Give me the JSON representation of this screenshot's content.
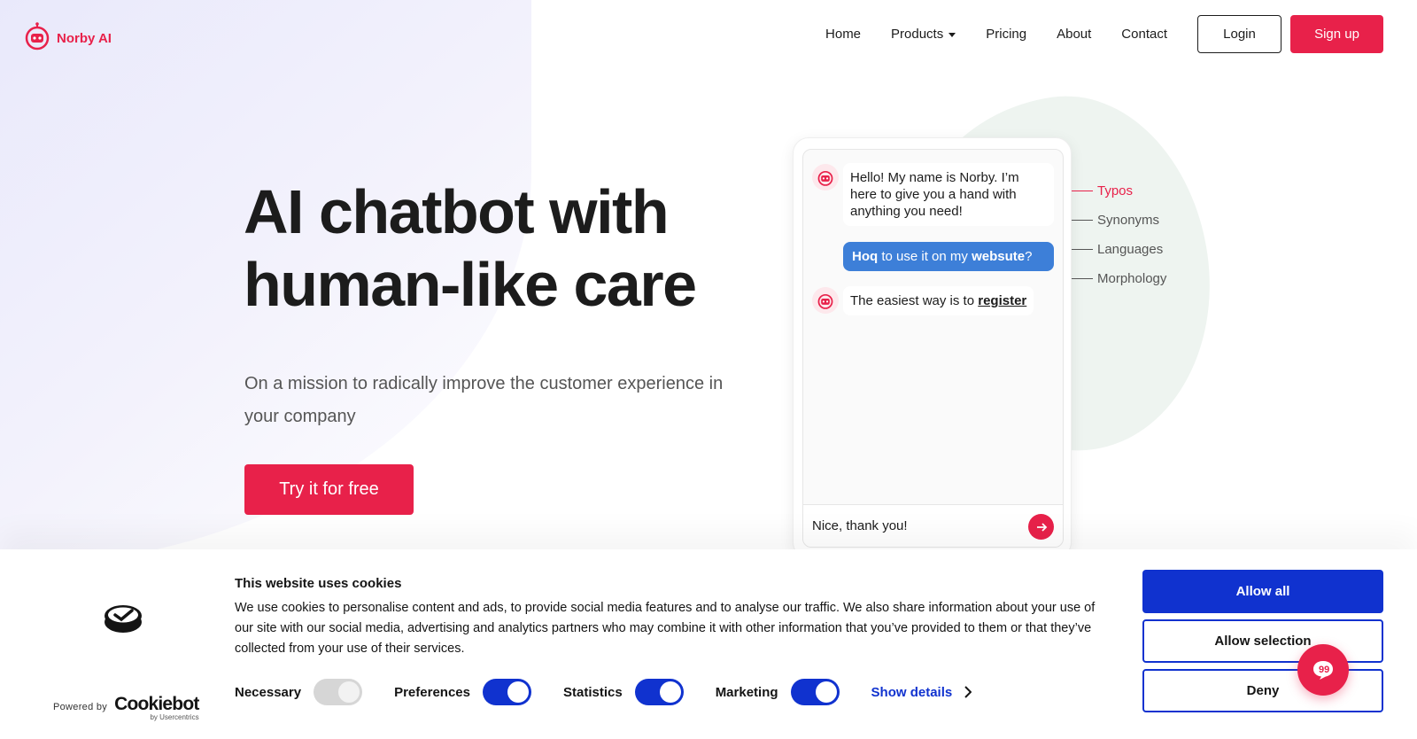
{
  "brand": {
    "name": "Norby AI",
    "accent": "#e8214a",
    "icon": "robot-icon"
  },
  "nav": {
    "home": "Home",
    "products": "Products",
    "pricing": "Pricing",
    "about": "About",
    "contact": "Contact",
    "login": "Login",
    "signup": "Sign up"
  },
  "hero": {
    "title_line1": "AI chatbot with",
    "title_line2": "human-like care",
    "subtitle": "On a mission to radically improve the customer experience in your company",
    "cta": "Try it for free"
  },
  "chat": {
    "bot_greeting": "Hello! My name is Norby. I’m here to give you a hand with anything you need!",
    "user_msg": {
      "word1": "Hoq",
      "middle": " to use it on my ",
      "word2": "websute",
      "end": "?"
    },
    "bot_reply_prefix": "The easiest way is to ",
    "bot_reply_link": "register",
    "input_value": "Nice, thank you!",
    "send_icon": "arrow-right-icon"
  },
  "features": [
    "Typos",
    "Synonyms",
    "Languages",
    "Morphology"
  ],
  "cookie": {
    "title": "This website uses cookies",
    "text": "We use cookies to personalise content and ads, to provide social media features and to analyse our traffic. We also share information about your use of our site with our social media, advertising and analytics partners who may combine it with other information that you’ve provided to them or that they’ve collected from your use of their services.",
    "powered_by": "Powered by",
    "brand": "Cookiebot",
    "brand_sub": "by Usercentrics",
    "toggles": {
      "necessary": "Necessary",
      "preferences": "Preferences",
      "statistics": "Statistics",
      "marketing": "Marketing"
    },
    "show_details": "Show details",
    "allow_all": "Allow all",
    "allow_selection": "Allow selection",
    "deny": "Deny",
    "accent": "#1032cf"
  }
}
